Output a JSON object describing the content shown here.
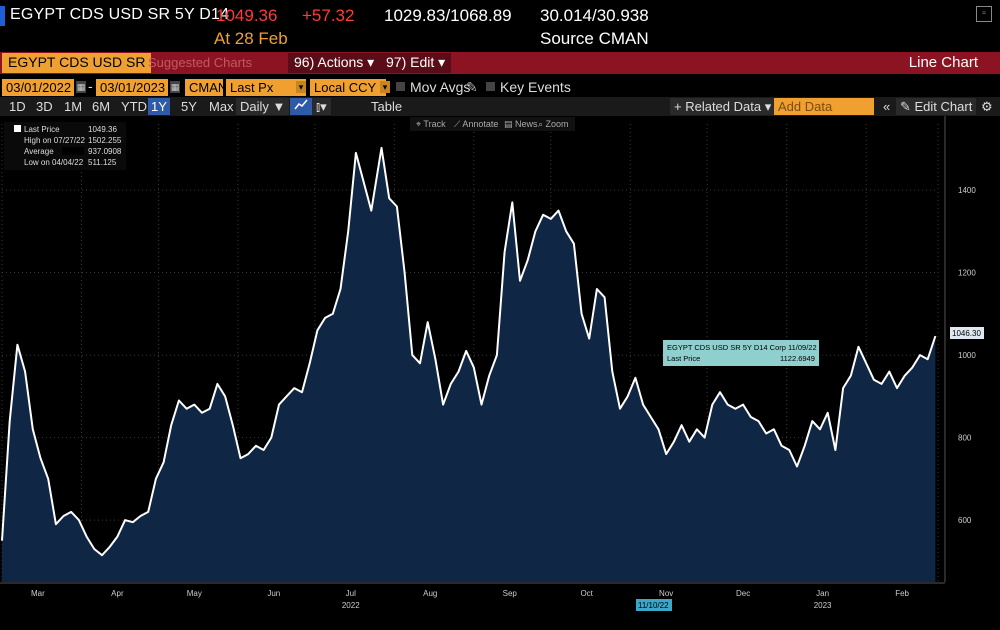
{
  "header": {
    "security": "EGYPT CDS USD SR 5Y D14",
    "last_price": "1049.36",
    "change": "+57.32",
    "bid_ask": "1029.83/1068.89",
    "range": "30.014/30.938",
    "as_of": "At 28 Feb",
    "source": "Source CMAN"
  },
  "menubar": {
    "security_field": "EGYPT CDS USD SR",
    "suggested": "Suggested Charts",
    "actions": "96) Actions ▾",
    "edit": "97) Edit ▾",
    "title": "Line Chart"
  },
  "params": {
    "start_date": "03/01/2022",
    "end_date": "03/01/2023",
    "source": "CMAN",
    "field": "Last Px",
    "currency": "Local CCY",
    "mov_avgs": "Mov Avgs",
    "key_events": "Key Events"
  },
  "toolbar": {
    "periods": [
      "1D",
      "3D",
      "1M",
      "6M",
      "YTD",
      "1Y",
      "5Y",
      "Max"
    ],
    "active_period": "1Y",
    "frequency": "Daily ▼",
    "table": "Table",
    "related_data": "+ Related Data ▾",
    "add_data_placeholder": "Add Data",
    "collapse": "«",
    "edit_chart": "✎ Edit Chart",
    "settings": "⚙"
  },
  "chart_tools": {
    "track": "Track",
    "annotate": "Annotate",
    "news": "News",
    "zoom": "Zoom"
  },
  "legend": {
    "rows": [
      {
        "label": "Last Price",
        "value": "1049.36"
      },
      {
        "label": "High on 07/27/22",
        "value": "1502.255"
      },
      {
        "label": "Average",
        "value": "937.0908"
      },
      {
        "label": "Low on 04/04/22",
        "value": "511.125"
      }
    ]
  },
  "tooltip": {
    "title": "EGYPT CDS USD SR 5Y D14 Corp 11/09/22",
    "label": "Last Price",
    "value": "1122.6949"
  },
  "last_value_tag": "1046.30",
  "crosshair_date": "11/10/22",
  "colors": {
    "background": "#000000",
    "area_fill": "#0f2645",
    "line": "#ffffff",
    "menubar": "#8c1321",
    "field": "#f0a030",
    "price_red": "#ff3b3b",
    "tooltip_bg": "#8fd0cf"
  },
  "chart_data": {
    "type": "area",
    "title": "",
    "xlabel": "",
    "ylabel": "",
    "ylim": [
      450,
      1560
    ],
    "yticks": [
      600,
      800,
      1000,
      1200,
      1400
    ],
    "xlim": [
      "2022-03-01",
      "2023-03-01"
    ],
    "month_labels": [
      {
        "date": "2022-03-15",
        "label": "Mar"
      },
      {
        "date": "2022-04-15",
        "label": "Apr"
      },
      {
        "date": "2022-05-15",
        "label": "May"
      },
      {
        "date": "2022-06-15",
        "label": "Jun"
      },
      {
        "date": "2022-07-15",
        "label": "Jul"
      },
      {
        "date": "2022-08-15",
        "label": "Aug"
      },
      {
        "date": "2022-09-15",
        "label": "Sep"
      },
      {
        "date": "2022-10-15",
        "label": "Oct"
      },
      {
        "date": "2022-11-15",
        "label": "Nov"
      },
      {
        "date": "2022-12-15",
        "label": "Dec"
      },
      {
        "date": "2023-01-15",
        "label": "Jan"
      },
      {
        "date": "2023-02-15",
        "label": "Feb"
      }
    ],
    "year_labels": [
      {
        "date": "2022-07-15",
        "label": "2022"
      },
      {
        "date": "2023-01-15",
        "label": "2023"
      }
    ],
    "series": [
      {
        "name": "Last Price",
        "points": [
          [
            "2022-03-01",
            550
          ],
          [
            "2022-03-04",
            840
          ],
          [
            "2022-03-07",
            1025
          ],
          [
            "2022-03-10",
            960
          ],
          [
            "2022-03-13",
            820
          ],
          [
            "2022-03-16",
            750
          ],
          [
            "2022-03-19",
            700
          ],
          [
            "2022-03-22",
            590
          ],
          [
            "2022-03-25",
            610
          ],
          [
            "2022-03-28",
            620
          ],
          [
            "2022-03-31",
            600
          ],
          [
            "2022-04-03",
            560
          ],
          [
            "2022-04-06",
            530
          ],
          [
            "2022-04-09",
            515
          ],
          [
            "2022-04-12",
            535
          ],
          [
            "2022-04-15",
            560
          ],
          [
            "2022-04-18",
            600
          ],
          [
            "2022-04-21",
            595
          ],
          [
            "2022-04-24",
            610
          ],
          [
            "2022-04-27",
            620
          ],
          [
            "2022-04-30",
            700
          ],
          [
            "2022-05-03",
            740
          ],
          [
            "2022-05-06",
            830
          ],
          [
            "2022-05-09",
            890
          ],
          [
            "2022-05-12",
            870
          ],
          [
            "2022-05-15",
            880
          ],
          [
            "2022-05-18",
            860
          ],
          [
            "2022-05-21",
            870
          ],
          [
            "2022-05-24",
            930
          ],
          [
            "2022-05-27",
            900
          ],
          [
            "2022-05-30",
            830
          ],
          [
            "2022-06-02",
            750
          ],
          [
            "2022-06-05",
            760
          ],
          [
            "2022-06-08",
            780
          ],
          [
            "2022-06-11",
            770
          ],
          [
            "2022-06-14",
            800
          ],
          [
            "2022-06-17",
            880
          ],
          [
            "2022-06-20",
            900
          ],
          [
            "2022-06-23",
            920
          ],
          [
            "2022-06-26",
            910
          ],
          [
            "2022-06-29",
            980
          ],
          [
            "2022-07-02",
            1060
          ],
          [
            "2022-07-05",
            1090
          ],
          [
            "2022-07-08",
            1100
          ],
          [
            "2022-07-11",
            1160
          ],
          [
            "2022-07-14",
            1300
          ],
          [
            "2022-07-17",
            1490
          ],
          [
            "2022-07-20",
            1420
          ],
          [
            "2022-07-23",
            1350
          ],
          [
            "2022-07-27",
            1502
          ],
          [
            "2022-07-30",
            1380
          ],
          [
            "2022-08-02",
            1360
          ],
          [
            "2022-08-05",
            1200
          ],
          [
            "2022-08-08",
            1000
          ],
          [
            "2022-08-11",
            980
          ],
          [
            "2022-08-14",
            1080
          ],
          [
            "2022-08-17",
            990
          ],
          [
            "2022-08-20",
            880
          ],
          [
            "2022-08-23",
            930
          ],
          [
            "2022-08-26",
            960
          ],
          [
            "2022-08-29",
            1010
          ],
          [
            "2022-09-01",
            970
          ],
          [
            "2022-09-04",
            880
          ],
          [
            "2022-09-07",
            950
          ],
          [
            "2022-09-10",
            1000
          ],
          [
            "2022-09-13",
            1250
          ],
          [
            "2022-09-16",
            1370
          ],
          [
            "2022-09-19",
            1180
          ],
          [
            "2022-09-22",
            1230
          ],
          [
            "2022-09-25",
            1300
          ],
          [
            "2022-09-28",
            1340
          ],
          [
            "2022-10-01",
            1330
          ],
          [
            "2022-10-04",
            1350
          ],
          [
            "2022-10-07",
            1300
          ],
          [
            "2022-10-10",
            1270
          ],
          [
            "2022-10-13",
            1100
          ],
          [
            "2022-10-16",
            1040
          ],
          [
            "2022-10-19",
            1160
          ],
          [
            "2022-10-22",
            1140
          ],
          [
            "2022-10-25",
            960
          ],
          [
            "2022-10-28",
            870
          ],
          [
            "2022-10-31",
            900
          ],
          [
            "2022-11-03",
            945
          ],
          [
            "2022-11-06",
            880
          ],
          [
            "2022-11-09",
            850
          ],
          [
            "2022-11-12",
            820
          ],
          [
            "2022-11-15",
            760
          ],
          [
            "2022-11-18",
            790
          ],
          [
            "2022-11-21",
            830
          ],
          [
            "2022-11-24",
            790
          ],
          [
            "2022-11-27",
            820
          ],
          [
            "2022-11-30",
            800
          ],
          [
            "2022-12-03",
            880
          ],
          [
            "2022-12-06",
            910
          ],
          [
            "2022-12-09",
            880
          ],
          [
            "2022-12-12",
            870
          ],
          [
            "2022-12-15",
            880
          ],
          [
            "2022-12-18",
            850
          ],
          [
            "2022-12-21",
            840
          ],
          [
            "2022-12-24",
            810
          ],
          [
            "2022-12-27",
            820
          ],
          [
            "2022-12-30",
            780
          ],
          [
            "2023-01-02",
            770
          ],
          [
            "2023-01-05",
            730
          ],
          [
            "2023-01-08",
            780
          ],
          [
            "2023-01-11",
            840
          ],
          [
            "2023-01-14",
            820
          ],
          [
            "2023-01-17",
            860
          ],
          [
            "2023-01-20",
            770
          ],
          [
            "2023-01-23",
            920
          ],
          [
            "2023-01-26",
            950
          ],
          [
            "2023-01-29",
            1020
          ],
          [
            "2023-02-01",
            980
          ],
          [
            "2023-02-04",
            940
          ],
          [
            "2023-02-07",
            930
          ],
          [
            "2023-02-10",
            960
          ],
          [
            "2023-02-13",
            920
          ],
          [
            "2023-02-16",
            950
          ],
          [
            "2023-02-19",
            970
          ],
          [
            "2023-02-22",
            1000
          ],
          [
            "2023-02-25",
            990
          ],
          [
            "2023-02-28",
            1046
          ]
        ]
      }
    ],
    "grid": true
  }
}
